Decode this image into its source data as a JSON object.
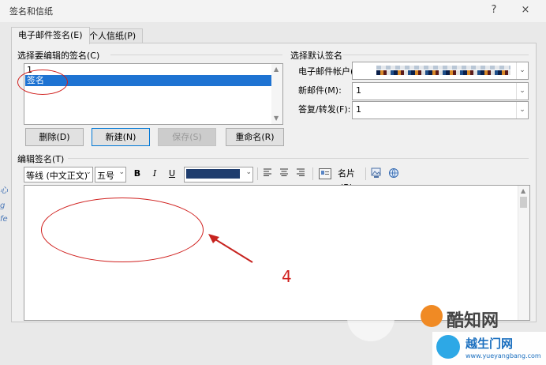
{
  "window": {
    "title": "签名和信纸",
    "help_icon": "?",
    "close_icon": "×"
  },
  "tabs": [
    {
      "label": "电子邮件签名(E)"
    },
    {
      "label": "个人信纸(P)"
    }
  ],
  "signature_list": {
    "label": "选择要编辑的签名(C)",
    "items": [
      "1",
      "签名"
    ],
    "selected_index": 1
  },
  "buttons": {
    "delete": "删除(D)",
    "new": "新建(N)",
    "save": "保存(S)",
    "rename": "重命名(R)"
  },
  "default_signature": {
    "group_label": "选择默认签名",
    "account_label": "电子邮件帐户(A):",
    "new_mail_label": "新邮件(M):",
    "new_mail_value": "1",
    "reply_label": "答复/转发(F):",
    "reply_value": "1"
  },
  "editor": {
    "label": "编辑签名(T)",
    "font": "等线 (中文正文)",
    "size": "五号",
    "bold": "B",
    "italic": "I",
    "underline": "U",
    "font_color": "#1f3d6e",
    "business_card": "名片(B)"
  },
  "annotation": {
    "step": "4",
    "color": "#d0201e"
  },
  "watermark": {
    "text1": "酷知网",
    "text2": "越生门网",
    "url": "www.yueyangbang.com"
  }
}
